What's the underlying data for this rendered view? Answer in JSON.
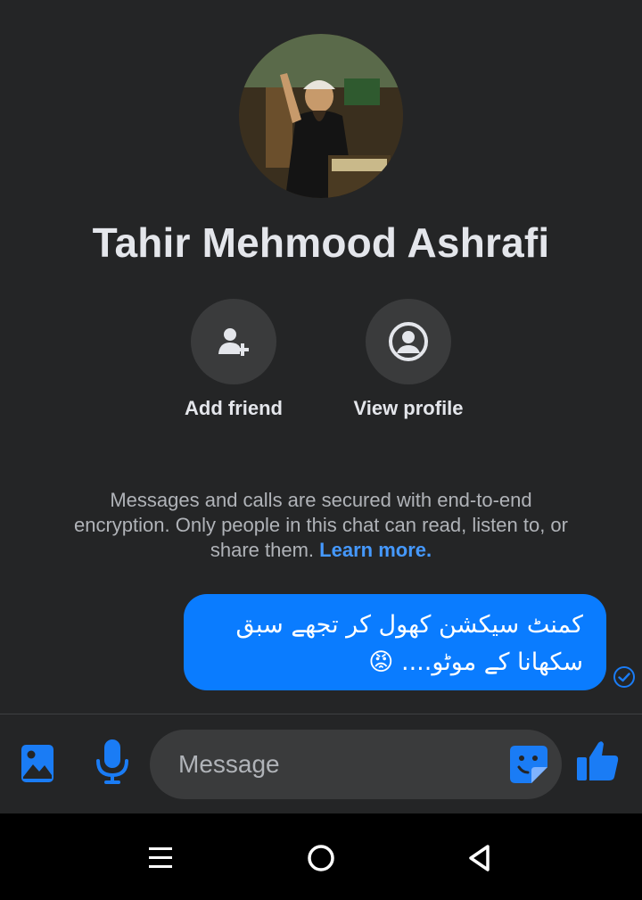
{
  "profile": {
    "name": "Tahir Mehmood Ashrafi"
  },
  "actions": {
    "add_friend": "Add friend",
    "view_profile": "View profile"
  },
  "notice": {
    "text": "Messages and calls are secured with end-to-end encryption. Only people in this chat can read, listen to, or share them.",
    "link": "Learn more."
  },
  "messages": [
    {
      "direction": "outgoing",
      "text_line1": "کمنٹ سیکشن کھول کر تجھے سبق",
      "text_line2": "سکھانا کے موٹو....",
      "emoji": "😡",
      "status": "sent"
    }
  ],
  "composer": {
    "placeholder": "Message"
  },
  "icons": {
    "photo": "photo-icon",
    "mic": "microphone-icon",
    "sticker": "sticker-icon",
    "like": "thumbs-up-icon",
    "add_friend": "add-person-icon",
    "view_profile": "profile-circle-icon",
    "read_receipt": "check-circle-icon"
  },
  "colors": {
    "background": "#242526",
    "accent": "#0a7cff",
    "link": "#4599ff",
    "icon_blue": "#1a7cf5"
  }
}
